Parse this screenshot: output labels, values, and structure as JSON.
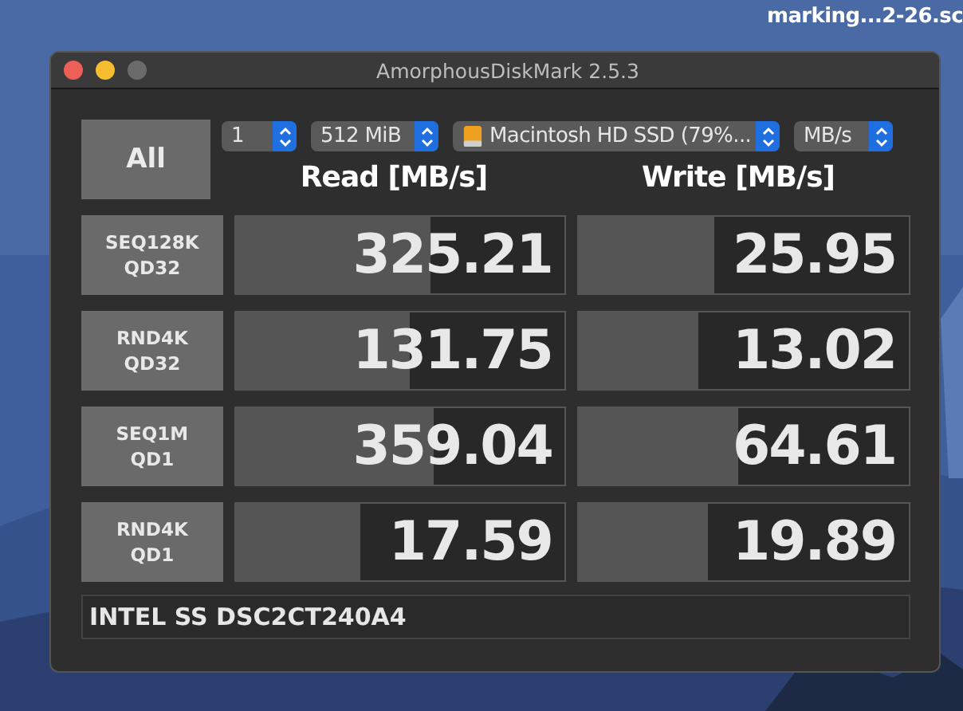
{
  "desktop": {
    "file_label": "marking...2-26.sc"
  },
  "window": {
    "title": "AmorphousDiskMark 2.5.3"
  },
  "all_button": "All",
  "selectors": [
    {
      "kind": "plain",
      "value": "1"
    },
    {
      "kind": "plain",
      "value": "512 MiB"
    },
    {
      "kind": "drive",
      "value": "Macintosh HD SSD (79%..."
    },
    {
      "kind": "plain",
      "value": "MB/s"
    }
  ],
  "headers": [
    "Read [MB/s]",
    "Write [MB/s]"
  ],
  "rows": [
    {
      "test": [
        "SEQ128K",
        "QD32"
      ],
      "read": {
        "value": "325.21",
        "level": 0.59
      },
      "write": {
        "value": "25.95",
        "level": 0.41
      }
    },
    {
      "test": [
        "RND4K",
        "QD32"
      ],
      "read": {
        "value": "131.75",
        "level": 0.53
      },
      "write": {
        "value": "13.02",
        "level": 0.36
      }
    },
    {
      "test": [
        "SEQ1M",
        "QD1"
      ],
      "read": {
        "value": "359.04",
        "level": 0.6
      },
      "write": {
        "value": "64.61",
        "level": 0.48
      }
    },
    {
      "test": [
        "RND4K",
        "QD1"
      ],
      "read": {
        "value": "17.59",
        "level": 0.38
      },
      "write": {
        "value": "19.89",
        "level": 0.39
      }
    }
  ],
  "drive_model": "INTEL SS DSC2CT240A4"
}
